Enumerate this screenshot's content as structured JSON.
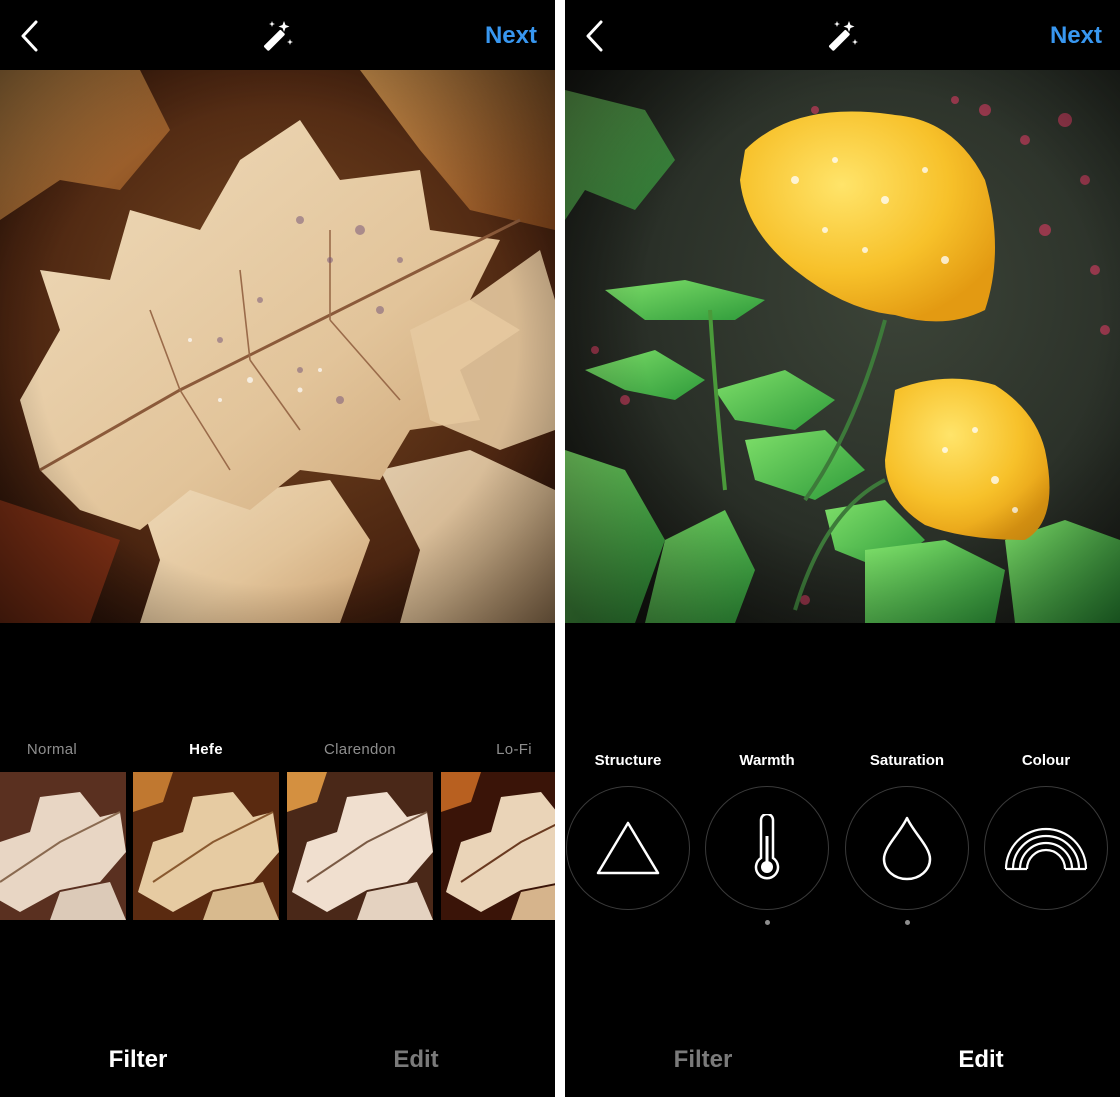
{
  "left_screen": {
    "next_label": "Next",
    "filters": [
      {
        "label": "Normal"
      },
      {
        "label": "Hefe"
      },
      {
        "label": "Clarendon"
      },
      {
        "label": "Lo-Fi"
      }
    ],
    "selected_filter": "Hefe",
    "tabs": {
      "filter": "Filter",
      "edit": "Edit"
    },
    "active_tab": "Filter"
  },
  "right_screen": {
    "next_label": "Next",
    "tools": [
      {
        "label": "Structure",
        "icon": "triangle-icon"
      },
      {
        "label": "Warmth",
        "icon": "thermometer-icon"
      },
      {
        "label": "Saturation",
        "icon": "droplet-icon"
      },
      {
        "label": "Colour",
        "icon": "rainbow-icon"
      }
    ],
    "tabs": {
      "filter": "Filter",
      "edit": "Edit"
    },
    "active_tab": "Edit"
  },
  "colors": {
    "accent": "#3897f0",
    "background": "#000000",
    "inactive_text": "#8e8e8e"
  }
}
